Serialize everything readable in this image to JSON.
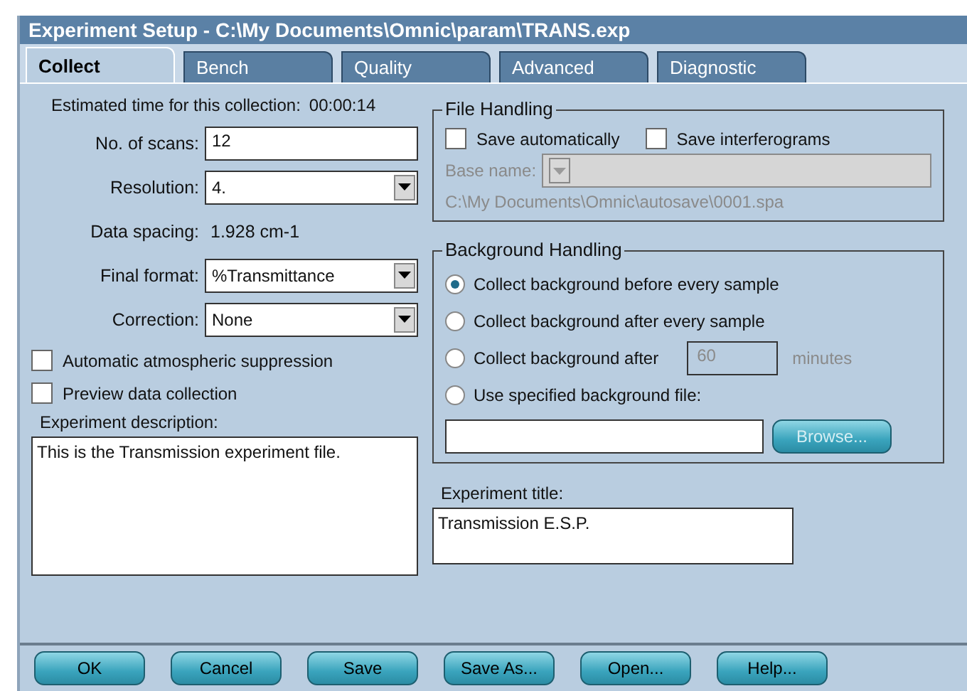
{
  "window": {
    "title": "Experiment Setup - C:\\My Documents\\Omnic\\param\\TRANS.exp"
  },
  "tabs": [
    {
      "label": "Collect",
      "selected": true
    },
    {
      "label": "Bench",
      "selected": false
    },
    {
      "label": "Quality",
      "selected": false
    },
    {
      "label": "Advanced",
      "selected": false
    },
    {
      "label": "Diagnostic",
      "selected": false
    }
  ],
  "estimated_time": {
    "label": "Estimated time for this collection:",
    "value": "00:00:14"
  },
  "left_fields": [
    {
      "kind": "input",
      "label": "No. of scans:",
      "value": "12"
    },
    {
      "kind": "dropdown",
      "label": "Resolution:",
      "value": "4."
    },
    {
      "kind": "readout",
      "label": "Data spacing:",
      "value": "1.928 cm-1"
    },
    {
      "kind": "dropdown",
      "label": "Final format:",
      "value": "%Transmittance"
    },
    {
      "kind": "dropdown",
      "label": "Correction:",
      "value": "None"
    }
  ],
  "options": [
    {
      "label": "Automatic atmospheric suppression",
      "checked": false
    },
    {
      "label": "Preview data collection",
      "checked": false
    }
  ],
  "experiment_description": {
    "label": "Experiment description:",
    "value": "This is the Transmission experiment file."
  },
  "file_handling": {
    "title": "File Handling",
    "checkboxes": [
      {
        "label": "Save automatically",
        "checked": false
      },
      {
        "label": "Save interferograms",
        "checked": false
      }
    ],
    "base_name": {
      "label": "Base name:",
      "disabled": true
    },
    "path": "C:\\My Documents\\Omnic\\autosave\\0001.spa"
  },
  "background_handling": {
    "title": "Background Handling",
    "options": [
      {
        "label": "Collect background before every sample",
        "selected": true
      },
      {
        "label": "Collect background after every sample",
        "selected": false
      },
      {
        "label": "Collect background after",
        "selected": false,
        "value": "60",
        "unit": "minutes",
        "disabled": true
      },
      {
        "label": "Use specified background file:",
        "selected": false
      }
    ],
    "browse_button": {
      "label": "Browse...",
      "disabled": true
    }
  },
  "experiment_title": {
    "label": "Experiment title:",
    "value": "Transmission E.S.P."
  },
  "buttons": [
    "OK",
    "Cancel",
    "Save",
    "Save As...",
    "Open...",
    "Help..."
  ]
}
